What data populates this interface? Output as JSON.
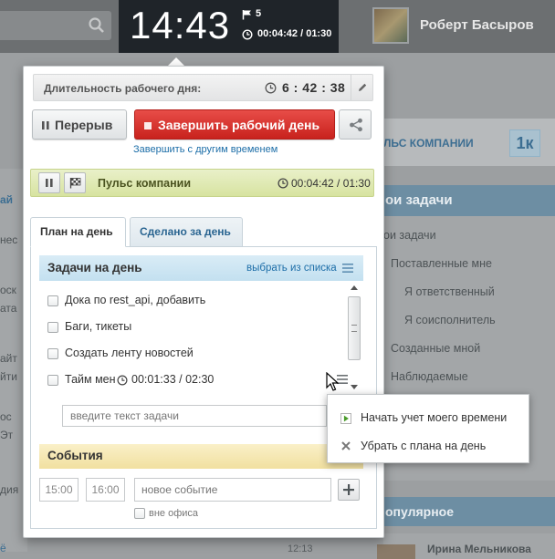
{
  "clock": {
    "time": "14:43",
    "flag_count": "5",
    "timer": "00:04:42 / 01:30"
  },
  "user": {
    "name": "Роберт Басыров"
  },
  "background": {
    "pulse_label": "ЛЬС КОМПАНИИ",
    "badge": "1к",
    "my_tasks_head": "ои задачи",
    "right_items": [
      "ои задачи",
      "Поставленные мне",
      "Я ответственный",
      "Я соисполнитель",
      "Созданные мной",
      "Наблюдаемые"
    ],
    "popular_head": "опулярное",
    "popular_name": "Ирина Мельникова",
    "bottom_time": "12:13"
  },
  "popup": {
    "duration_label": "Длительность рабочего дня:",
    "duration_value": "6 : 42 : 38",
    "pause_label": "Перерыв",
    "finish_label": "Завершить рабочий день",
    "finish_other_link": "Завершить с другим временем",
    "pulse_label": "Пульс компании",
    "pulse_timer": "00:04:42 / 01:30",
    "tabs": [
      {
        "label": "План на день",
        "active": true
      },
      {
        "label": "Сделано за день",
        "active": false
      }
    ],
    "tasks_title": "Задачи на день",
    "choose_link": "выбрать из списка",
    "tasks": [
      {
        "text": "Дока по rest_api, добавить"
      },
      {
        "text": "Баги, тикеты"
      },
      {
        "text": "Создать ленту новостей"
      },
      {
        "text": "Тайм мен",
        "time": "00:01:33 / 02:30"
      }
    ],
    "task_input_placeholder": "введите текст задачи",
    "events_title": "События",
    "event_from": "15:00",
    "event_to": "16:00",
    "event_placeholder": "новое событие",
    "out_of_office_label": "вне офиса"
  },
  "context_menu": {
    "items": [
      {
        "label": "Начать учет моего времени",
        "icon": "play-icon"
      },
      {
        "label": "Убрать с плана на день",
        "icon": "cross-icon"
      }
    ]
  },
  "colors": {
    "finish_button": "#d9322d",
    "link": "#1d6ea8",
    "pulse_bar": "#dfe8b2",
    "tasks_header": "#cde6f3",
    "events_header": "#f5e6b0"
  }
}
